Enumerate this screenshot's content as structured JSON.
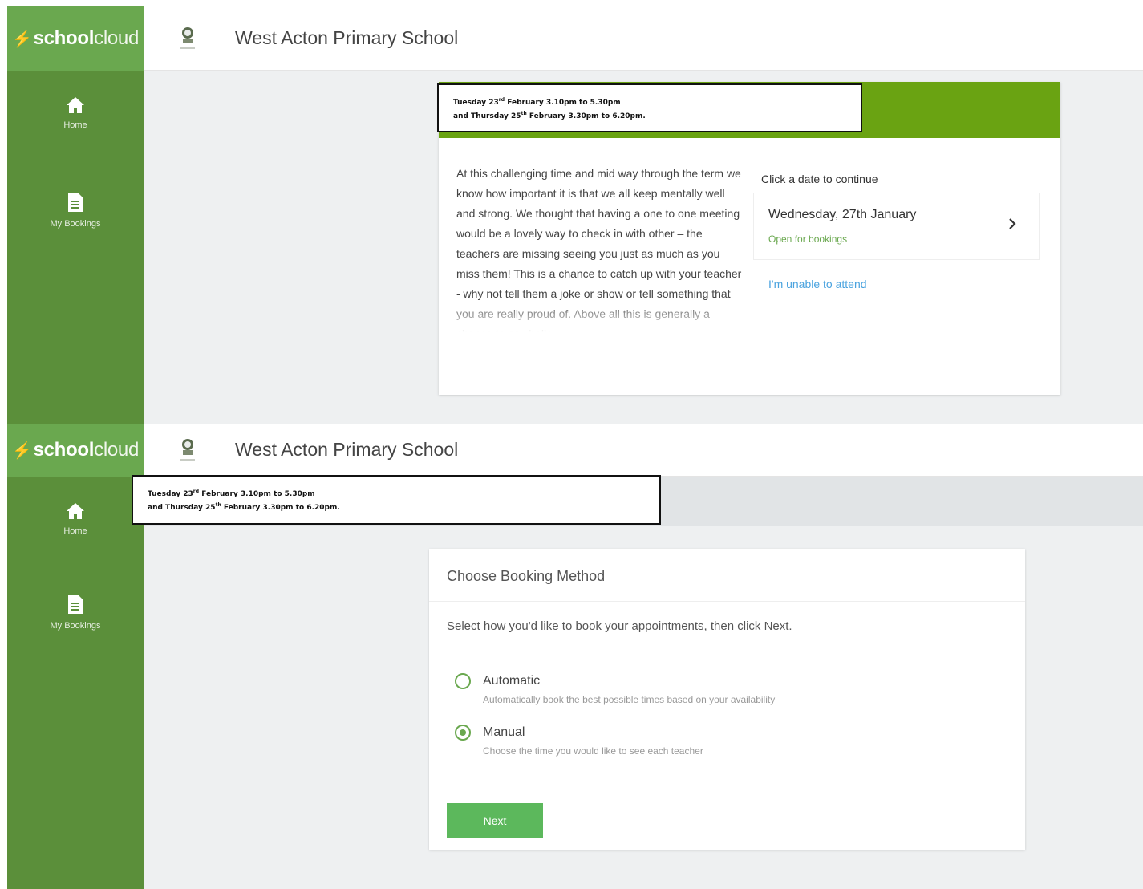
{
  "brand": {
    "logo_bold": "school",
    "logo_light": "cloud"
  },
  "school": {
    "name": "West Acton Primary School"
  },
  "nav": [
    {
      "label": "Home",
      "icon": "home-icon"
    },
    {
      "label": "My Bookings",
      "icon": "document-icon"
    }
  ],
  "notice": {
    "day1": "Tuesday 23",
    "day1_sup": "rd",
    "line1_rest": " February 3.10pm to 5.30pm",
    "day2": "and Thursday 25",
    "day2_sup": "th",
    "line2_rest": " February 3.30pm to 6.20pm."
  },
  "event_page": {
    "intro_text": "At this challenging time and mid way through the term we know how important it is that we all keep mentally well and strong. We thought that having a one to one meeting would be a lovely way to check in with other – the teachers are missing seeing you just as much as you miss them! This is a chance to catch up with your teacher - why not tell them a joke or show or tell something that you are really proud of. Above all this is generally a chance to say hello",
    "dates_title": "Click a date to continue",
    "date_label": "Wednesday, 27th January",
    "date_status": "Open for bookings",
    "unable_link": "I'm unable to attend"
  },
  "booking_method": {
    "title": "Choose Booking Method",
    "instruction": "Select how you'd like to book your appointments, then click Next.",
    "options": [
      {
        "label": "Automatic",
        "description": "Automatically book the best possible times based on your availability",
        "selected": false
      },
      {
        "label": "Manual",
        "description": "Choose the time you would like to see each teacher",
        "selected": true
      }
    ],
    "next_label": "Next"
  },
  "colors": {
    "sidebar": "#5b8f3a",
    "logo_bg": "#6aa84f",
    "header_green": "#6aa312",
    "link": "#4aa3df",
    "button": "#5cb85c"
  }
}
